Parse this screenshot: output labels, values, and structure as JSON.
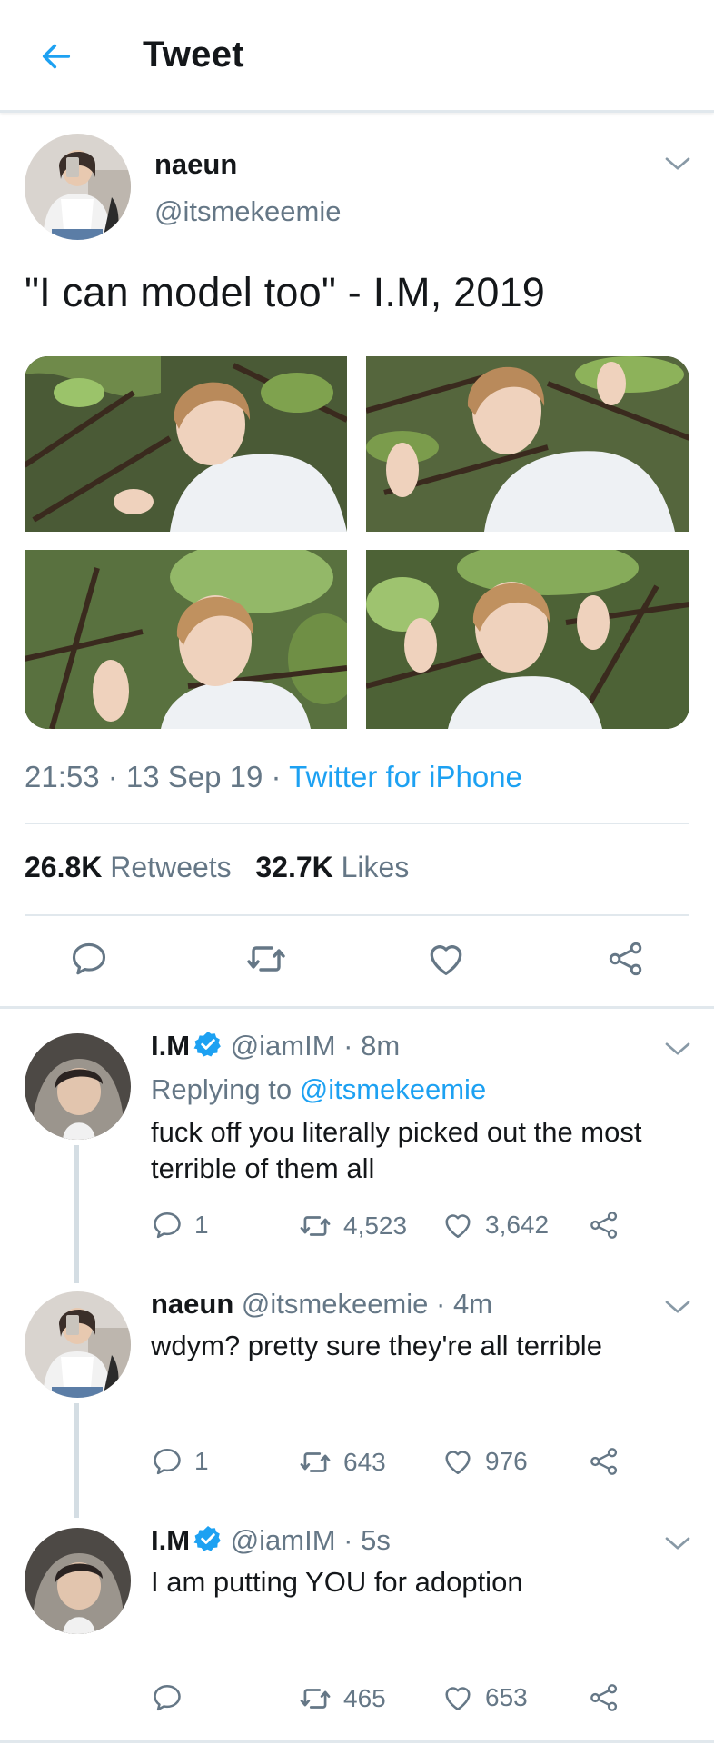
{
  "header": {
    "title": "Tweet",
    "back_icon": "arrow-left-icon",
    "accent": "#1da1f2"
  },
  "main_tweet": {
    "name": "naeun",
    "handle": "@itsmekeemie",
    "text": "\"I can model too\" - I.M, 2019",
    "media_count": 4,
    "time": "21:53",
    "date": "13 Sep 19",
    "source": "Twitter for iPhone",
    "retweets_count": "26.8K",
    "retweets_label": "Retweets",
    "likes_count": "32.7K",
    "likes_label": "Likes",
    "actions": [
      "reply-icon",
      "retweet-icon",
      "like-icon",
      "share-icon"
    ]
  },
  "replies": [
    {
      "name": "I.M",
      "verified": true,
      "handle": "@iamIM",
      "time": "8m",
      "replying_label": "Replying to",
      "replying_to": "@itsmekeemie",
      "text": "fuck off you literally picked out the most terrible of them all",
      "reply_count": "1",
      "retweet_count": "4,523",
      "like_count": "3,642"
    },
    {
      "name": "naeun",
      "verified": false,
      "handle": "@itsmekeemie",
      "time": "4m",
      "text": "wdym? pretty sure they're all terrible",
      "reply_count": "1",
      "retweet_count": "643",
      "like_count": "976"
    },
    {
      "name": "I.M",
      "verified": true,
      "handle": "@iamIM",
      "time": "5s",
      "text": "I am putting YOU for adoption",
      "reply_count": "",
      "retweet_count": "465",
      "like_count": "653"
    }
  ],
  "separator": " · "
}
